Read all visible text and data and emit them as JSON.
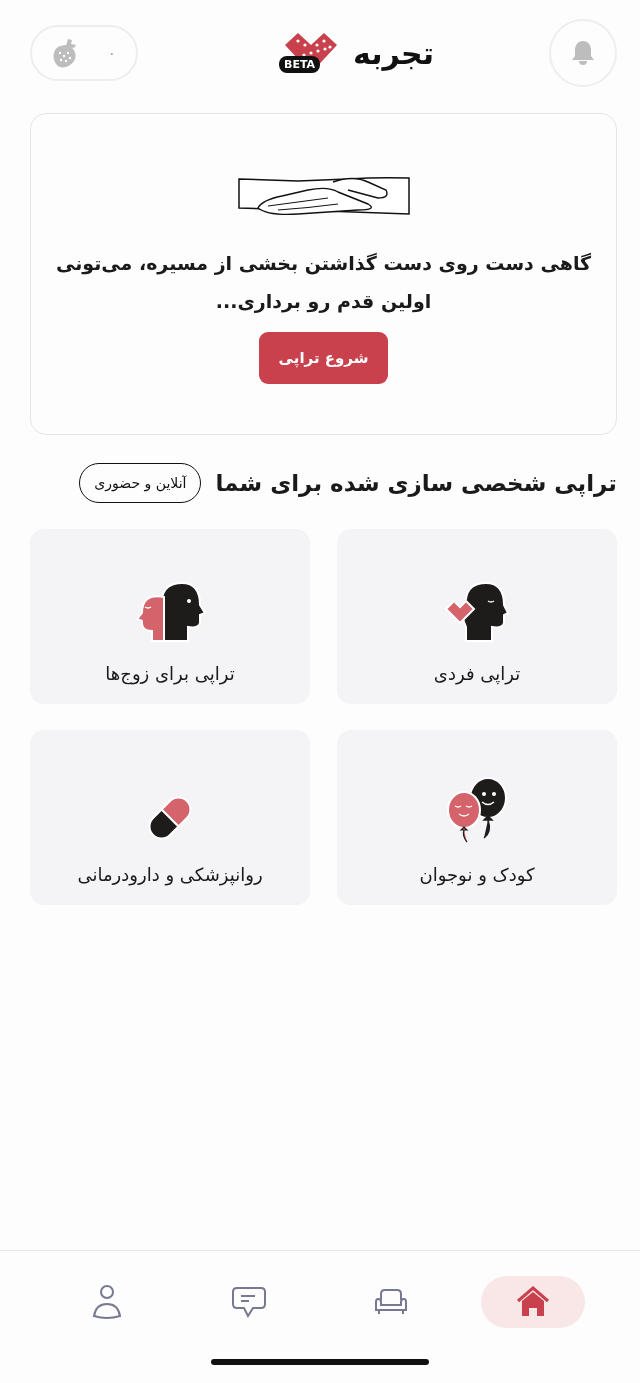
{
  "header": {
    "points": "۰",
    "logo": {
      "text": "تجربه",
      "badge": "BETA"
    }
  },
  "hero": {
    "text": "گاهی دست روی دست گذاشتن بخشی از مسیره، می‌تونی اولین قدم رو برداری...",
    "button": "شروع تراپی"
  },
  "section": {
    "title": "تراپی شخصی سازی شده برای شما",
    "tag": "آنلاین و حضوری"
  },
  "categories": [
    {
      "kind": "individual",
      "label": "تراپی فردی"
    },
    {
      "kind": "couples",
      "label": "تراپی برای زوج‌ها"
    },
    {
      "kind": "kids",
      "label": "کودک و نوجوان"
    },
    {
      "kind": "psychiatry",
      "label": "روانپزشکی و دارودرمانی"
    }
  ],
  "nav": [
    {
      "kind": "home",
      "selected": true
    },
    {
      "kind": "sofa",
      "selected": false
    },
    {
      "kind": "chat",
      "selected": false
    },
    {
      "kind": "profile",
      "selected": false
    }
  ]
}
